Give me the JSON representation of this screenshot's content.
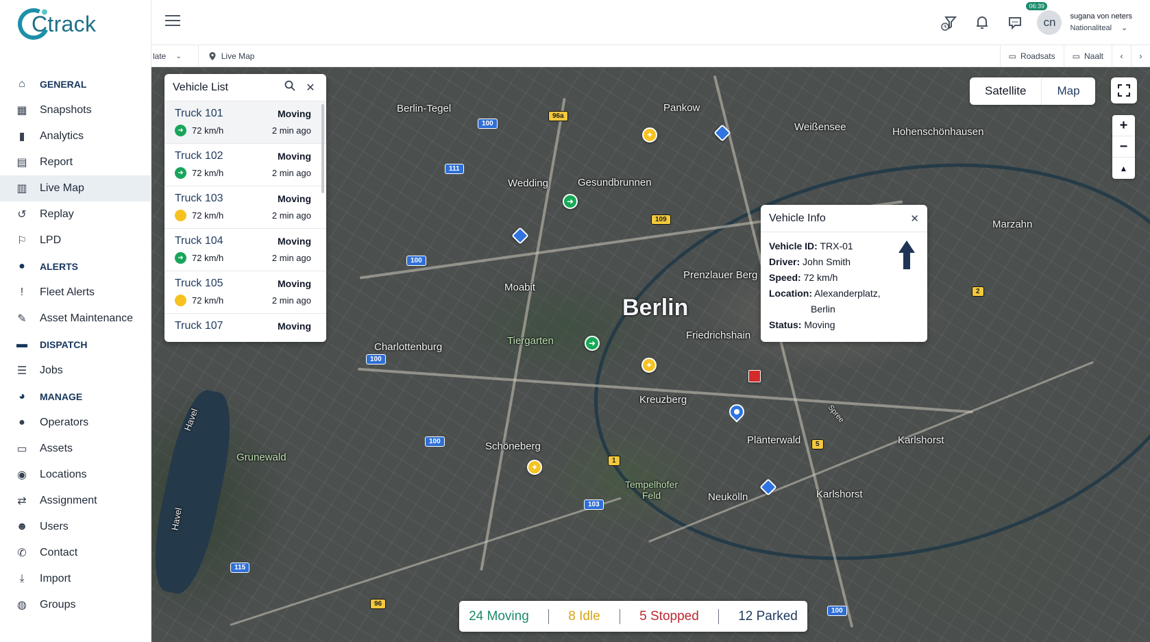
{
  "brand": {
    "name": "Ctrack"
  },
  "sidebar": {
    "groups": [
      {
        "section": "GENERAL",
        "items": [
          "Snapshots",
          "Analytics",
          "Report",
          "Live Map",
          "Replay",
          "LPD"
        ]
      },
      {
        "section": "ALERTS",
        "items": [
          "Fleet Alerts",
          "Asset Maintenance"
        ]
      },
      {
        "section": "DISPATCH",
        "items": [
          "Jobs"
        ]
      },
      {
        "section": "MANAGE",
        "items": [
          "Operators",
          "Assets",
          "Locations",
          "Assignment",
          "Users",
          "Contact",
          "Import",
          "Groups"
        ]
      }
    ],
    "active": "Live Map"
  },
  "topbar": {
    "time_badge": "06:39",
    "avatar_initials": "cn",
    "user_name": "sugana von neters",
    "user_sub": "Nationaliteal"
  },
  "subbar": {
    "left_partial": "late",
    "breadcrumb": "Live Map",
    "right": [
      "Roadsats",
      "Naalt"
    ]
  },
  "map": {
    "places": [
      "Berlin-Tegel",
      "Pankow",
      "Weißensee",
      "Hohenschönhausen",
      "Wedding",
      "Gesundbrunnen",
      "Marzahn",
      "Moabit",
      "Prenzlauer Berg",
      "Berlin",
      "Friedrichshain",
      "Charlottenburg",
      "Tiergarten",
      "Kreuzberg",
      "Schöneberg",
      "Plänterwald",
      "Karlshorst",
      "Grunewald",
      "Tempelhofer Feld",
      "Neukölln",
      "Karlshorst",
      "Havel",
      "Havel",
      "Spree"
    ],
    "roads": [
      "100",
      "96a",
      "111",
      "109",
      "100",
      "100",
      "100",
      "2",
      "1",
      "5",
      "103",
      "115",
      "96",
      "100"
    ],
    "view_toggle": [
      "Satellite",
      "Map"
    ],
    "zoom": [
      "+",
      "−",
      "▲"
    ]
  },
  "vehicle_list": {
    "title": "Vehicle List",
    "rows": [
      {
        "name": "Truck 101",
        "status": "Moving",
        "speed": "72 km/h",
        "time": "2 min ago",
        "icon": "green"
      },
      {
        "name": "Truck 102",
        "status": "Moving",
        "speed": "72 km/h",
        "time": "2 min ago",
        "icon": "green"
      },
      {
        "name": "Truck 103",
        "status": "Moving",
        "speed": "72 km/h",
        "time": "2 min ago",
        "icon": "yellow"
      },
      {
        "name": "Truck 104",
        "status": "Moving",
        "speed": "72 km/h",
        "time": "2 min ago",
        "icon": "green"
      },
      {
        "name": "Truck 105",
        "status": "Moving",
        "speed": "72 km/h",
        "time": "2 min ago",
        "icon": "yellow"
      },
      {
        "name": "Truck 107",
        "status": "Moving",
        "speed": "",
        "time": "",
        "icon": ""
      }
    ]
  },
  "vehicle_info": {
    "title": "Vehicle Info",
    "id_label": "Vehicle ID:",
    "id": "TRX-01",
    "driver_label": "Driver:",
    "driver": "John Smith",
    "speed_label": "Speed:",
    "speed": "72 km/h",
    "location_label": "Location:",
    "location_1": "Alexanderplatz,",
    "location_2": "Berlin",
    "status_label": "Status:",
    "status": "Moving"
  },
  "status_bar": {
    "moving": "24 Moving",
    "idle": "8 Idle",
    "stopped": "5 Stopped",
    "parked": "12 Parked",
    "colors": {
      "moving": "#1b8a6b",
      "idle": "#d9a514",
      "stopped": "#c0262d",
      "parked": "#1e3a5f"
    }
  }
}
